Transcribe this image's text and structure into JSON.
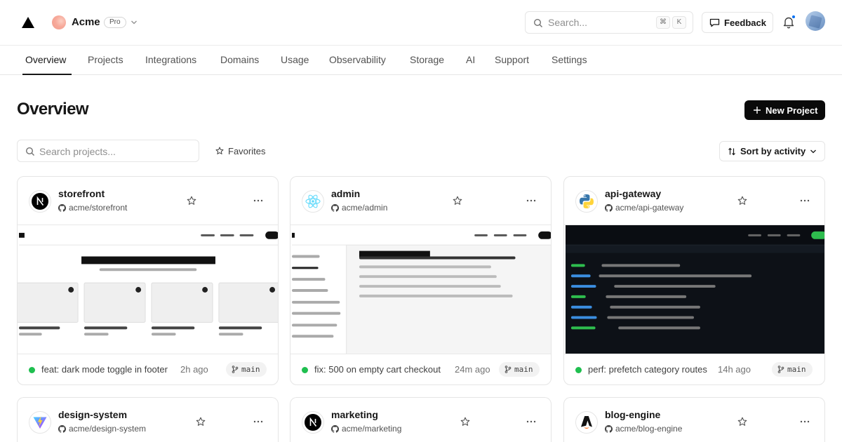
{
  "header": {
    "team_name": "Acme",
    "plan_badge": "Pro",
    "search_placeholder": "Search...",
    "shortcut_keys": [
      "⌘",
      "K"
    ],
    "feedback_label": "Feedback",
    "has_notifications": true
  },
  "tabs": [
    {
      "label": "Overview",
      "active": true
    },
    {
      "label": "Projects"
    },
    {
      "label": "Integrations"
    },
    {
      "label": "Domains"
    },
    {
      "label": "Usage"
    },
    {
      "label": "Observability"
    },
    {
      "label": "Storage"
    },
    {
      "label": "AI"
    },
    {
      "label": "Support"
    },
    {
      "label": "Settings"
    }
  ],
  "page": {
    "title": "Overview",
    "new_project_label": "New Project",
    "project_search_placeholder": "Search projects...",
    "favorites_label": "Favorites",
    "sort_label": "Sort by activity"
  },
  "projects": [
    {
      "name": "storefront",
      "repo": "acme/storefront",
      "icon": "nextjs-icon",
      "commit": "feat: dark mode toggle in footer",
      "time": "2h ago",
      "branch": "main",
      "status_color": "#1fbf4f"
    },
    {
      "name": "admin",
      "repo": "acme/admin",
      "icon": "react-icon",
      "commit": "fix: 500 on empty cart checkout",
      "time": "24m ago",
      "branch": "main",
      "status_color": "#1fbf4f"
    },
    {
      "name": "api-gateway",
      "repo": "acme/api-gateway",
      "icon": "python-icon",
      "commit": "perf: prefetch category routes",
      "time": "14h ago",
      "branch": "main",
      "status_color": "#1fbf4f"
    },
    {
      "name": "design-system",
      "repo": "acme/design-system",
      "icon": "vite-icon"
    },
    {
      "name": "marketing",
      "repo": "acme/marketing",
      "icon": "nextjs-icon"
    },
    {
      "name": "blog-engine",
      "repo": "acme/blog-engine",
      "icon": "astro-icon"
    }
  ],
  "colors": {
    "accent": "#0a0a0a",
    "status_ready": "#1fbf4f",
    "notification": "#0070f3"
  }
}
